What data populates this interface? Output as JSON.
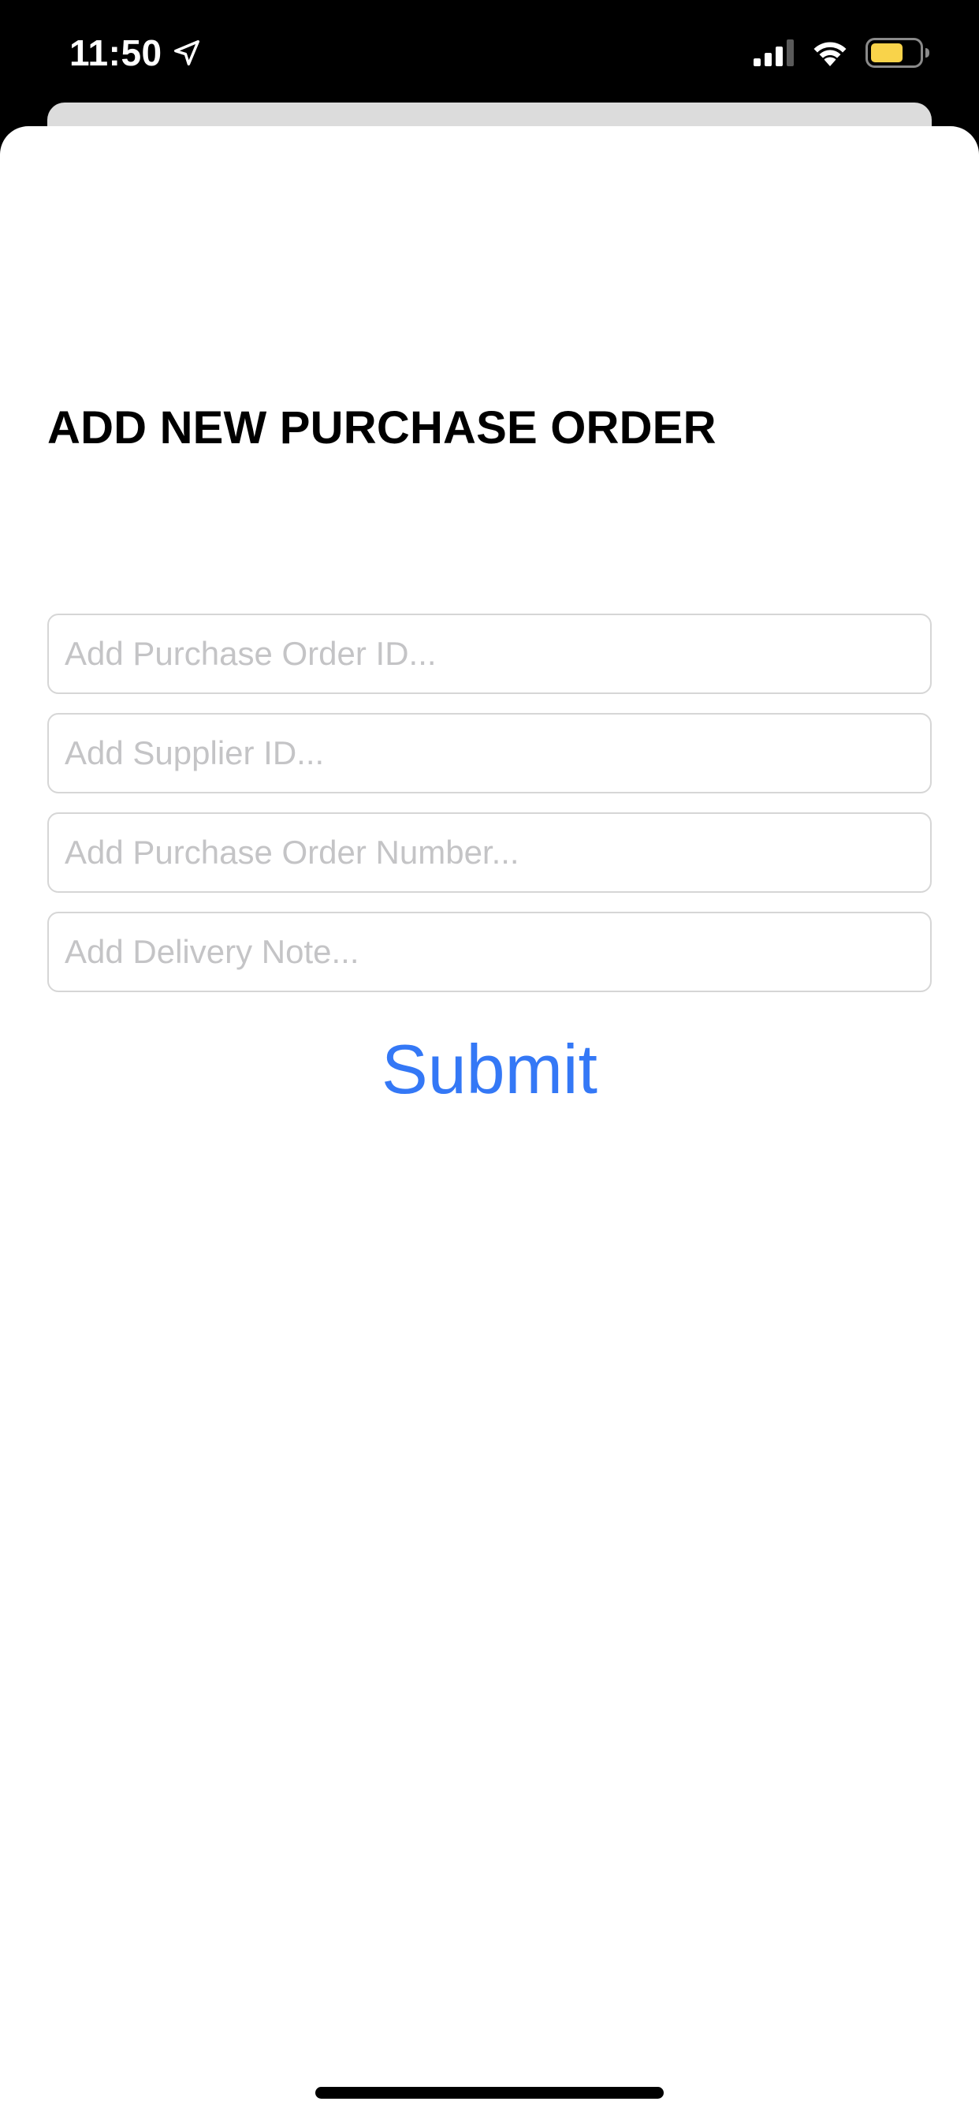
{
  "status_bar": {
    "time": "11:50",
    "icons": [
      "location-arrow-icon",
      "cellular-signal-icon",
      "wifi-icon",
      "battery-icon"
    ],
    "battery_color": "#f9d34a"
  },
  "form": {
    "title": "ADD NEW PURCHASE ORDER",
    "fields": [
      {
        "name": "purchase-order-id",
        "value": "",
        "placeholder": "Add Purchase Order ID..."
      },
      {
        "name": "supplier-id",
        "value": "",
        "placeholder": "Add Supplier ID..."
      },
      {
        "name": "purchase-order-number",
        "value": "",
        "placeholder": "Add Purchase Order Number..."
      },
      {
        "name": "delivery-note",
        "value": "",
        "placeholder": "Add Delivery Note..."
      }
    ],
    "submit_label": "Submit"
  },
  "colors": {
    "accent": "#3478f6",
    "placeholder": "#c4c4c6",
    "field_border": "#d6d6d6",
    "status_bar_background": "#000000",
    "sheet_background": "#ffffff"
  }
}
